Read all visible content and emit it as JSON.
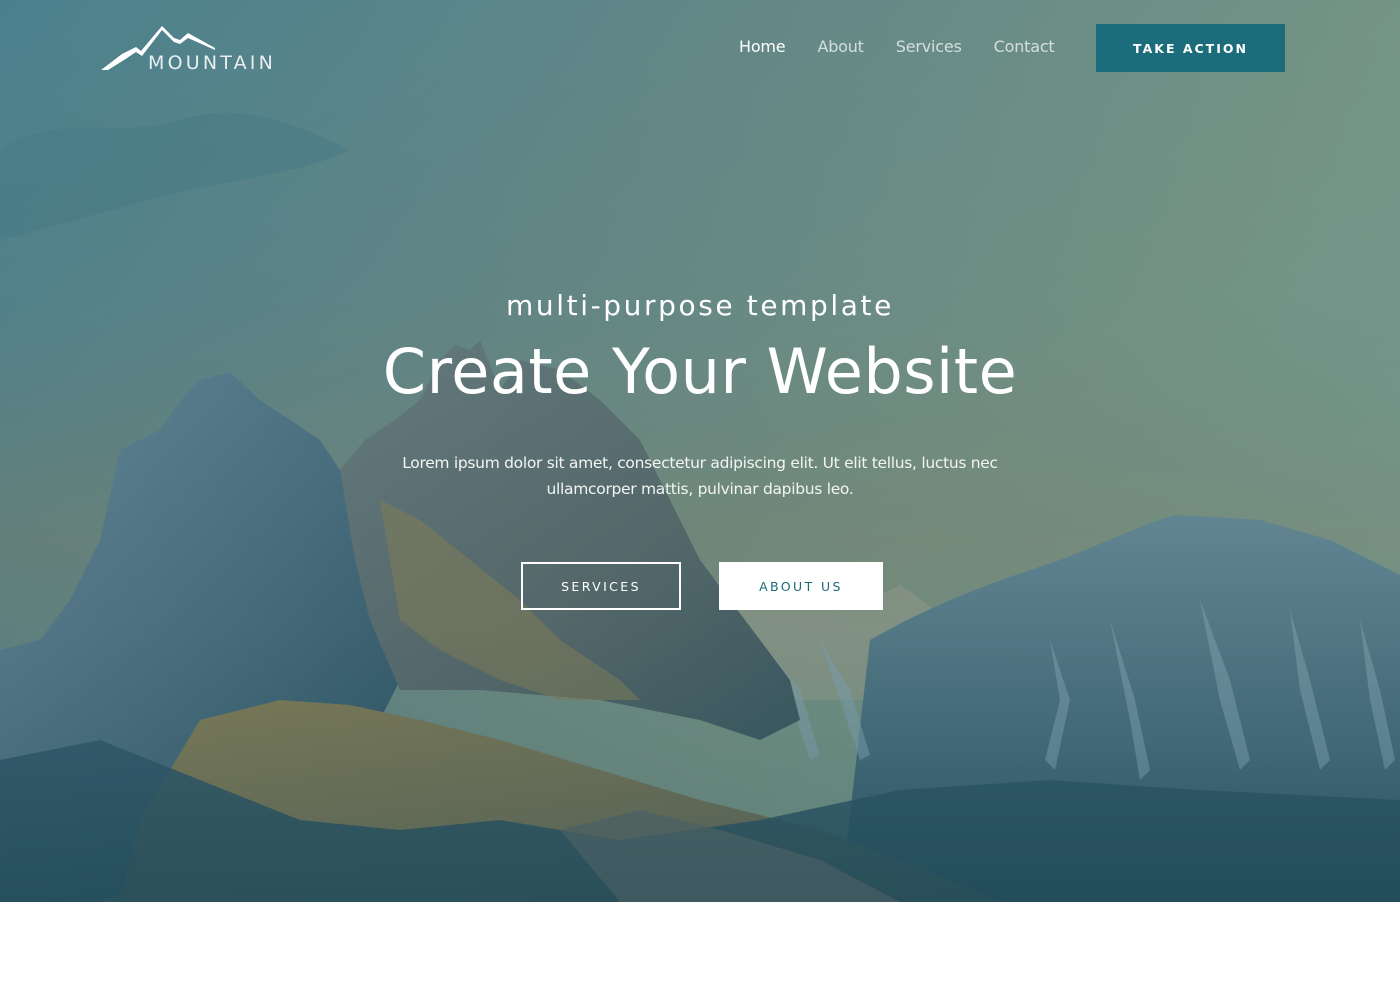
{
  "brand": {
    "name": "MOUNTAIN",
    "logo_icon": "mountain-peaks-icon"
  },
  "nav": {
    "items": [
      {
        "label": "Home",
        "active": true
      },
      {
        "label": "About",
        "active": false
      },
      {
        "label": "Services",
        "active": false
      },
      {
        "label": "Contact",
        "active": false
      }
    ],
    "cta_label": "TAKE ACTION"
  },
  "hero": {
    "subtitle": "multi-purpose template",
    "title": "Create Your Website",
    "description": "Lorem ipsum dolor sit amet, consectetur adipiscing elit. Ut elit tellus, luctus nec ullamcorper mattis, pulvinar dapibus leo.",
    "primary_button": "SERVICES",
    "secondary_button": "ABOUT US",
    "background_image": "mountain-landscape-photo"
  },
  "colors": {
    "accent": "#1c6d7b",
    "overlay": "#2a5f6b",
    "text_on_hero": "#ffffff",
    "secondary_button_text": "#1d6a7a"
  }
}
